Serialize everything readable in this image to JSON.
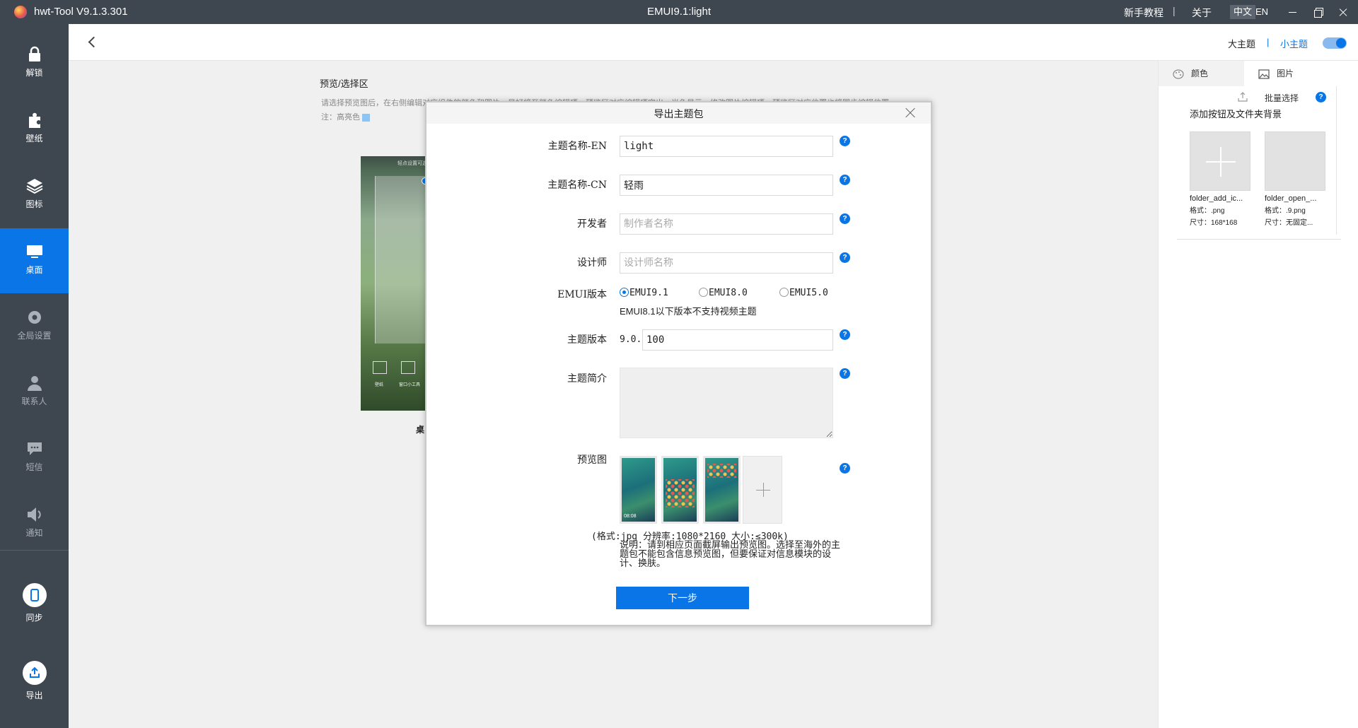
{
  "titlebar": {
    "app_title": "hwt-Tool V9.1.3.301",
    "center_title": "EMUI9.1:light",
    "tutorial": "新手教程",
    "separator": "|",
    "about": "关于",
    "lang_cn": "中文",
    "lang_en": "EN"
  },
  "sidebar": {
    "items": [
      {
        "label": "解锁",
        "icon": "lock-icon"
      },
      {
        "label": "壁纸",
        "icon": "puzzle-icon"
      },
      {
        "label": "图标",
        "icon": "layers-icon"
      },
      {
        "label": "桌面",
        "icon": "monitor-icon",
        "active": true
      },
      {
        "label": "全局设置",
        "icon": "gear-icon"
      },
      {
        "label": "联系人",
        "icon": "person-icon"
      },
      {
        "label": "短信",
        "icon": "message-icon"
      },
      {
        "label": "通知",
        "icon": "speaker-icon"
      },
      {
        "label": "同步",
        "icon": "phone-icon"
      },
      {
        "label": "导出",
        "icon": "export-icon"
      }
    ]
  },
  "header": {
    "big_theme": "大主题",
    "separator": "|",
    "small_theme": "小主题"
  },
  "main": {
    "preview_title": "预览/选择区",
    "preview_desc": "请选择预览图后，在右侧编辑对应组件的颜色和图片，是好将至颜色编辑项。预览区对应编辑项突出，光色显示。修改图片编辑项，预览区对应位置也将同步编辑位置",
    "preview_note": "注：高亮色",
    "phone_top_text": "轻点设置可选",
    "widget_wallpaper": "壁纸",
    "widget_tools": "窗口小工具",
    "phone_caption": "桌"
  },
  "right_panel": {
    "tab_color": "颜色",
    "tab_picture": "图片",
    "batch_select": "批量选择",
    "help": "?",
    "section_title": "添加按钮及文件夹背景",
    "assets": [
      {
        "name": "folder_add_ic...",
        "format": "格式：.png",
        "size": "尺寸：168*168"
      },
      {
        "name": "folder_open_...",
        "format": "格式：.9.png",
        "size": "尺寸：无固定..."
      }
    ]
  },
  "modal": {
    "title": "导出主题包",
    "help": "?",
    "fields": {
      "name_en_label": "主题名称-EN",
      "name_en_value": "light",
      "name_cn_label": "主题名称-CN",
      "name_cn_value": "轻雨",
      "developer_label": "开发者",
      "developer_placeholder": "制作者名称",
      "designer_label": "设计师",
      "designer_placeholder": "设计师名称",
      "emui_label": "EMUI版本",
      "emui_options": [
        "EMUI9.1",
        "EMUI8.0",
        "EMUI5.0"
      ],
      "emui_selected": "EMUI9.1",
      "emui_note": "EMUI8.1以下版本不支持视频主题",
      "version_label": "主题版本",
      "version_prefix": "9.0.",
      "version_value": "100",
      "intro_label": "主题简介",
      "preview_label": "预览图"
    },
    "shot_time": "08:08",
    "format_line": "(格式:jpg 分辨率:1080*2160 大小:≤300k)",
    "explain": "说明：请到相应页面截屏输出预览图。选择至海外的主题包不能包含信息预览图，但要保证对信息模块的设计、换肤。",
    "next_button": "下一步"
  },
  "colors": {
    "sidebar_bg": "#3e4650",
    "accent": "#0a75e6",
    "main_bg": "#f0f0f0"
  }
}
